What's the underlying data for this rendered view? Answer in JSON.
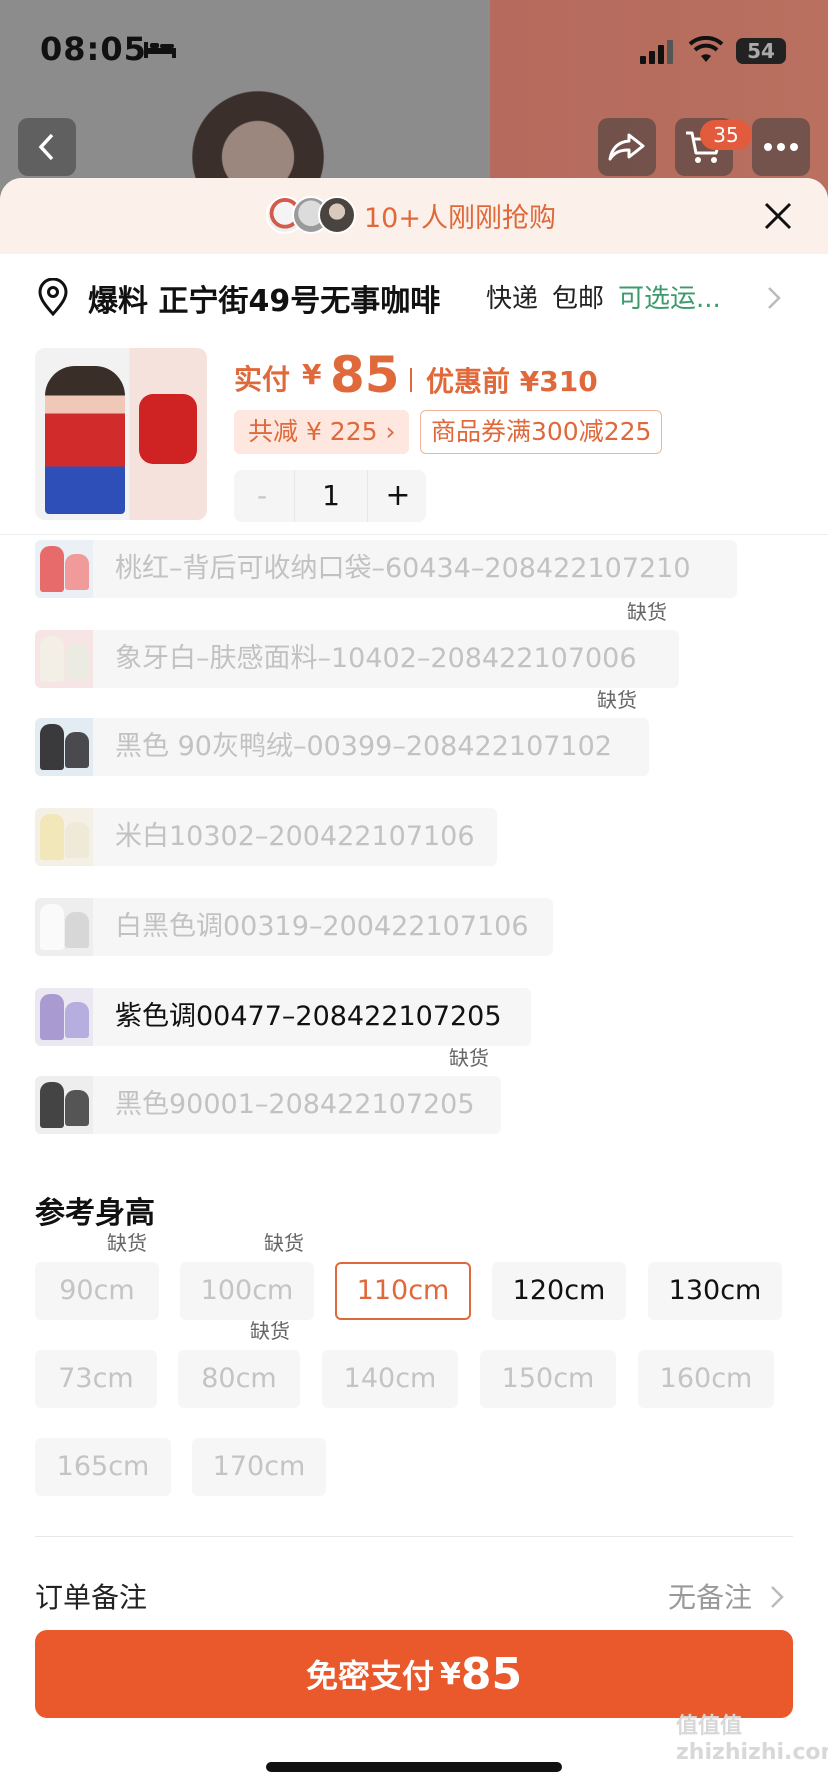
{
  "status_bar": {
    "time": "08:05",
    "battery": "54"
  },
  "nav": {
    "cart_count": "35"
  },
  "banner": {
    "buyers_text": "10+人刚刚抢购"
  },
  "address": {
    "name": "爆料 正宁街49号无事咖啡",
    "delivery": "快递",
    "shipping": "包邮",
    "option": "可选运..."
  },
  "product": {
    "price_label": "实付",
    "currency": "¥",
    "price": "85",
    "original_price": "优惠前 ¥310",
    "total_discount": "共减 ¥ 225 ›",
    "coupon": "商品券满300减225",
    "qty_minus": "-",
    "quantity": "1",
    "qty_plus": "+"
  },
  "colors": [
    {
      "label": "桃红–背后可收纳口袋–60434–208422107210",
      "available": false,
      "out_of_stock": ""
    },
    {
      "label": "象牙白–肤感面料–10402–208422107006",
      "available": false,
      "out_of_stock": "缺货"
    },
    {
      "label": "黑色 90灰鸭绒–00399–208422107102",
      "available": false,
      "out_of_stock": "缺货"
    },
    {
      "label": "米白10302–200422107106",
      "available": false,
      "out_of_stock": ""
    },
    {
      "label": "白黑色调00319–200422107106",
      "available": false,
      "out_of_stock": ""
    },
    {
      "label": "紫色调00477–208422107205",
      "available": true,
      "out_of_stock": ""
    },
    {
      "label": "黑色90001–208422107205",
      "available": false,
      "out_of_stock": "缺货"
    }
  ],
  "height": {
    "title": "参考身高",
    "options": [
      {
        "label": "90cm",
        "state": "disabled",
        "out_of_stock": "缺货"
      },
      {
        "label": "100cm",
        "state": "disabled",
        "out_of_stock": "缺货"
      },
      {
        "label": "110cm",
        "state": "selected",
        "out_of_stock": ""
      },
      {
        "label": "120cm",
        "state": "enabled",
        "out_of_stock": ""
      },
      {
        "label": "130cm",
        "state": "enabled",
        "out_of_stock": ""
      },
      {
        "label": "73cm",
        "state": "disabled",
        "out_of_stock": ""
      },
      {
        "label": "80cm",
        "state": "disabled",
        "out_of_stock": "缺货"
      },
      {
        "label": "140cm",
        "state": "disabled",
        "out_of_stock": ""
      },
      {
        "label": "150cm",
        "state": "disabled",
        "out_of_stock": ""
      },
      {
        "label": "160cm",
        "state": "disabled",
        "out_of_stock": ""
      },
      {
        "label": "165cm",
        "state": "disabled",
        "out_of_stock": ""
      },
      {
        "label": "170cm",
        "state": "disabled",
        "out_of_stock": ""
      }
    ]
  },
  "remark": {
    "label": "订单备注",
    "value": "无备注"
  },
  "pay": {
    "label": "免密支付",
    "currency": "¥",
    "amount": "85"
  },
  "watermark": "值值值 zhizhizhi.com",
  "colors_theme": {
    "accent": "#e0693b",
    "pay_button": "#e9592b",
    "shipping_option": "#3b9b6a"
  }
}
